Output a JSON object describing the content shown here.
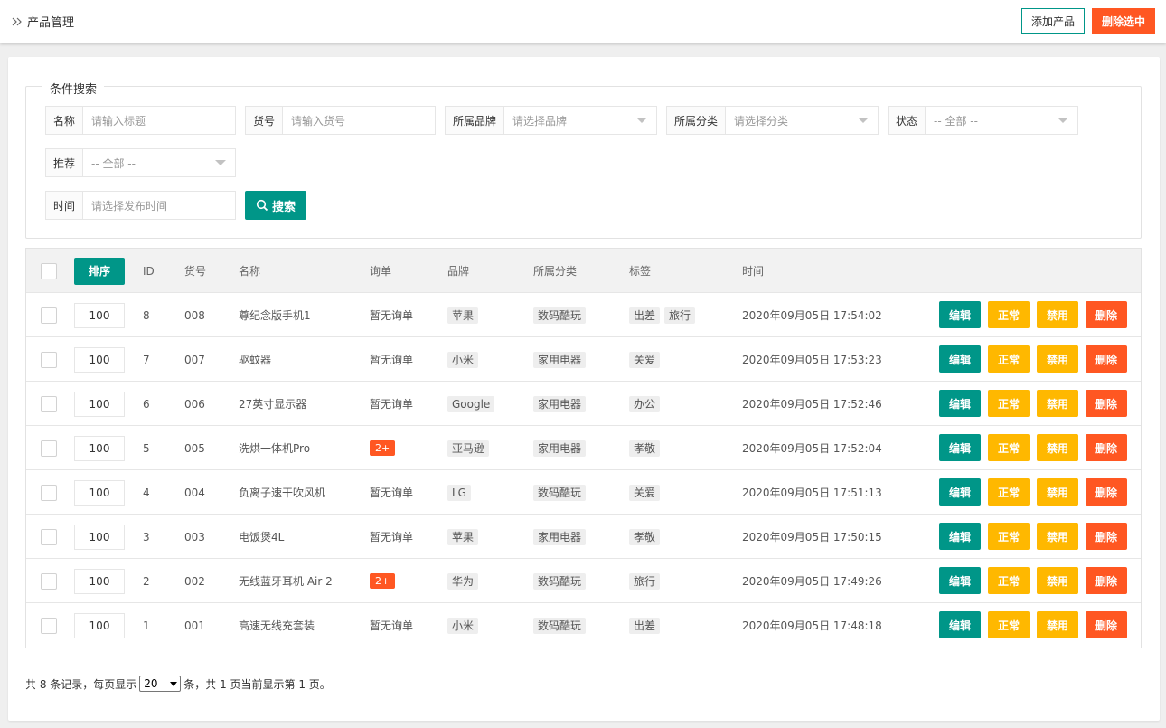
{
  "header": {
    "title": "产品管理",
    "add_label": "添加产品",
    "delete_selected_label": "删除选中"
  },
  "search": {
    "legend": "条件搜索",
    "name": {
      "label": "名称",
      "placeholder": "请输入标题"
    },
    "sku": {
      "label": "货号",
      "placeholder": "请输入货号"
    },
    "brand": {
      "label": "所属品牌",
      "placeholder": "请选择品牌"
    },
    "category": {
      "label": "所属分类",
      "placeholder": "请选择分类"
    },
    "status": {
      "label": "状态",
      "value": "-- 全部 --"
    },
    "recommend": {
      "label": "推荐",
      "value": "-- 全部 --"
    },
    "time": {
      "label": "时间",
      "placeholder": "请选择发布时间"
    },
    "search_label": "搜索"
  },
  "table": {
    "sort_button": "排序",
    "columns": {
      "id": "ID",
      "sku": "货号",
      "name": "名称",
      "inquiry": "询单",
      "brand": "品牌",
      "category": "所属分类",
      "tags": "标签",
      "time": "时间"
    },
    "actions": {
      "edit": "编辑",
      "normal": "正常",
      "disable": "禁用",
      "delete": "删除"
    },
    "rows": [
      {
        "sort": "100",
        "id": "8",
        "sku": "008",
        "name": "尊纪念版手机1",
        "inquiry": "暂无询单",
        "inquiry_badge": false,
        "brand": "苹果",
        "category": "数码酷玩",
        "tags": [
          "出差",
          "旅行"
        ],
        "time": "2020年09月05日 17:54:02"
      },
      {
        "sort": "100",
        "id": "7",
        "sku": "007",
        "name": "驱蚊器",
        "inquiry": "暂无询单",
        "inquiry_badge": false,
        "brand": "小米",
        "category": "家用电器",
        "tags": [
          "关爱"
        ],
        "time": "2020年09月05日 17:53:23"
      },
      {
        "sort": "100",
        "id": "6",
        "sku": "006",
        "name": "27英寸显示器",
        "inquiry": "暂无询单",
        "inquiry_badge": false,
        "brand": "Google",
        "category": "家用电器",
        "tags": [
          "办公"
        ],
        "time": "2020年09月05日 17:52:46"
      },
      {
        "sort": "100",
        "id": "5",
        "sku": "005",
        "name": "洗烘一体机Pro",
        "inquiry": "2+",
        "inquiry_badge": true,
        "brand": "亚马逊",
        "category": "家用电器",
        "tags": [
          "孝敬"
        ],
        "time": "2020年09月05日 17:52:04"
      },
      {
        "sort": "100",
        "id": "4",
        "sku": "004",
        "name": "负离子速干吹风机",
        "inquiry": "暂无询单",
        "inquiry_badge": false,
        "brand": "LG",
        "category": "数码酷玩",
        "tags": [
          "关爱"
        ],
        "time": "2020年09月05日 17:51:13"
      },
      {
        "sort": "100",
        "id": "3",
        "sku": "003",
        "name": "电饭煲4L",
        "inquiry": "暂无询单",
        "inquiry_badge": false,
        "brand": "苹果",
        "category": "家用电器",
        "tags": [
          "孝敬"
        ],
        "time": "2020年09月05日 17:50:15"
      },
      {
        "sort": "100",
        "id": "2",
        "sku": "002",
        "name": "无线蓝牙耳机 Air 2",
        "inquiry": "2+",
        "inquiry_badge": true,
        "brand": "华为",
        "category": "数码酷玩",
        "tags": [
          "旅行"
        ],
        "time": "2020年09月05日 17:49:26"
      },
      {
        "sort": "100",
        "id": "1",
        "sku": "001",
        "name": "高速无线充套装",
        "inquiry": "暂无询单",
        "inquiry_badge": false,
        "brand": "小米",
        "category": "数码酷玩",
        "tags": [
          "出差"
        ],
        "time": "2020年09月05日 17:48:18"
      }
    ]
  },
  "pager": {
    "prefix": "共 8 条记录，每页显示",
    "page_size": "20",
    "suffix": "条，共 1 页当前显示第 1 页。"
  },
  "colors": {
    "primary": "#009688",
    "warning": "#ffb800",
    "danger": "#ff5722"
  }
}
